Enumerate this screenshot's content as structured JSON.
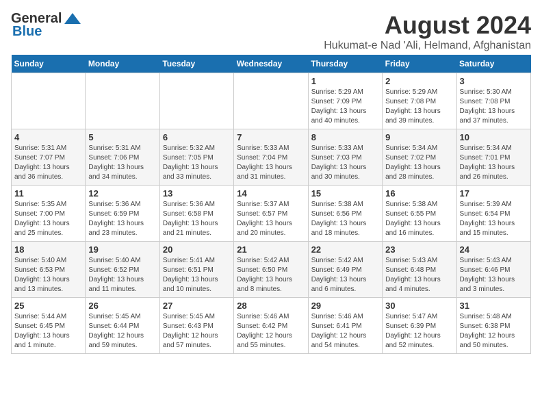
{
  "logo": {
    "general": "General",
    "blue": "Blue"
  },
  "header": {
    "month_year": "August 2024",
    "location": "Hukumat-e Nad 'Ali, Helmand, Afghanistan"
  },
  "columns": [
    "Sunday",
    "Monday",
    "Tuesday",
    "Wednesday",
    "Thursday",
    "Friday",
    "Saturday"
  ],
  "weeks": [
    {
      "days": [
        {
          "num": "",
          "info": ""
        },
        {
          "num": "",
          "info": ""
        },
        {
          "num": "",
          "info": ""
        },
        {
          "num": "",
          "info": ""
        },
        {
          "num": "1",
          "info": "Sunrise: 5:29 AM\nSunset: 7:09 PM\nDaylight: 13 hours\nand 40 minutes."
        },
        {
          "num": "2",
          "info": "Sunrise: 5:29 AM\nSunset: 7:08 PM\nDaylight: 13 hours\nand 39 minutes."
        },
        {
          "num": "3",
          "info": "Sunrise: 5:30 AM\nSunset: 7:08 PM\nDaylight: 13 hours\nand 37 minutes."
        }
      ]
    },
    {
      "days": [
        {
          "num": "4",
          "info": "Sunrise: 5:31 AM\nSunset: 7:07 PM\nDaylight: 13 hours\nand 36 minutes."
        },
        {
          "num": "5",
          "info": "Sunrise: 5:31 AM\nSunset: 7:06 PM\nDaylight: 13 hours\nand 34 minutes."
        },
        {
          "num": "6",
          "info": "Sunrise: 5:32 AM\nSunset: 7:05 PM\nDaylight: 13 hours\nand 33 minutes."
        },
        {
          "num": "7",
          "info": "Sunrise: 5:33 AM\nSunset: 7:04 PM\nDaylight: 13 hours\nand 31 minutes."
        },
        {
          "num": "8",
          "info": "Sunrise: 5:33 AM\nSunset: 7:03 PM\nDaylight: 13 hours\nand 30 minutes."
        },
        {
          "num": "9",
          "info": "Sunrise: 5:34 AM\nSunset: 7:02 PM\nDaylight: 13 hours\nand 28 minutes."
        },
        {
          "num": "10",
          "info": "Sunrise: 5:34 AM\nSunset: 7:01 PM\nDaylight: 13 hours\nand 26 minutes."
        }
      ]
    },
    {
      "days": [
        {
          "num": "11",
          "info": "Sunrise: 5:35 AM\nSunset: 7:00 PM\nDaylight: 13 hours\nand 25 minutes."
        },
        {
          "num": "12",
          "info": "Sunrise: 5:36 AM\nSunset: 6:59 PM\nDaylight: 13 hours\nand 23 minutes."
        },
        {
          "num": "13",
          "info": "Sunrise: 5:36 AM\nSunset: 6:58 PM\nDaylight: 13 hours\nand 21 minutes."
        },
        {
          "num": "14",
          "info": "Sunrise: 5:37 AM\nSunset: 6:57 PM\nDaylight: 13 hours\nand 20 minutes."
        },
        {
          "num": "15",
          "info": "Sunrise: 5:38 AM\nSunset: 6:56 PM\nDaylight: 13 hours\nand 18 minutes."
        },
        {
          "num": "16",
          "info": "Sunrise: 5:38 AM\nSunset: 6:55 PM\nDaylight: 13 hours\nand 16 minutes."
        },
        {
          "num": "17",
          "info": "Sunrise: 5:39 AM\nSunset: 6:54 PM\nDaylight: 13 hours\nand 15 minutes."
        }
      ]
    },
    {
      "days": [
        {
          "num": "18",
          "info": "Sunrise: 5:40 AM\nSunset: 6:53 PM\nDaylight: 13 hours\nand 13 minutes."
        },
        {
          "num": "19",
          "info": "Sunrise: 5:40 AM\nSunset: 6:52 PM\nDaylight: 13 hours\nand 11 minutes."
        },
        {
          "num": "20",
          "info": "Sunrise: 5:41 AM\nSunset: 6:51 PM\nDaylight: 13 hours\nand 10 minutes."
        },
        {
          "num": "21",
          "info": "Sunrise: 5:42 AM\nSunset: 6:50 PM\nDaylight: 13 hours\nand 8 minutes."
        },
        {
          "num": "22",
          "info": "Sunrise: 5:42 AM\nSunset: 6:49 PM\nDaylight: 13 hours\nand 6 minutes."
        },
        {
          "num": "23",
          "info": "Sunrise: 5:43 AM\nSunset: 6:48 PM\nDaylight: 13 hours\nand 4 minutes."
        },
        {
          "num": "24",
          "info": "Sunrise: 5:43 AM\nSunset: 6:46 PM\nDaylight: 13 hours\nand 3 minutes."
        }
      ]
    },
    {
      "days": [
        {
          "num": "25",
          "info": "Sunrise: 5:44 AM\nSunset: 6:45 PM\nDaylight: 13 hours\nand 1 minute."
        },
        {
          "num": "26",
          "info": "Sunrise: 5:45 AM\nSunset: 6:44 PM\nDaylight: 12 hours\nand 59 minutes."
        },
        {
          "num": "27",
          "info": "Sunrise: 5:45 AM\nSunset: 6:43 PM\nDaylight: 12 hours\nand 57 minutes."
        },
        {
          "num": "28",
          "info": "Sunrise: 5:46 AM\nSunset: 6:42 PM\nDaylight: 12 hours\nand 55 minutes."
        },
        {
          "num": "29",
          "info": "Sunrise: 5:46 AM\nSunset: 6:41 PM\nDaylight: 12 hours\nand 54 minutes."
        },
        {
          "num": "30",
          "info": "Sunrise: 5:47 AM\nSunset: 6:39 PM\nDaylight: 12 hours\nand 52 minutes."
        },
        {
          "num": "31",
          "info": "Sunrise: 5:48 AM\nSunset: 6:38 PM\nDaylight: 12 hours\nand 50 minutes."
        }
      ]
    }
  ]
}
